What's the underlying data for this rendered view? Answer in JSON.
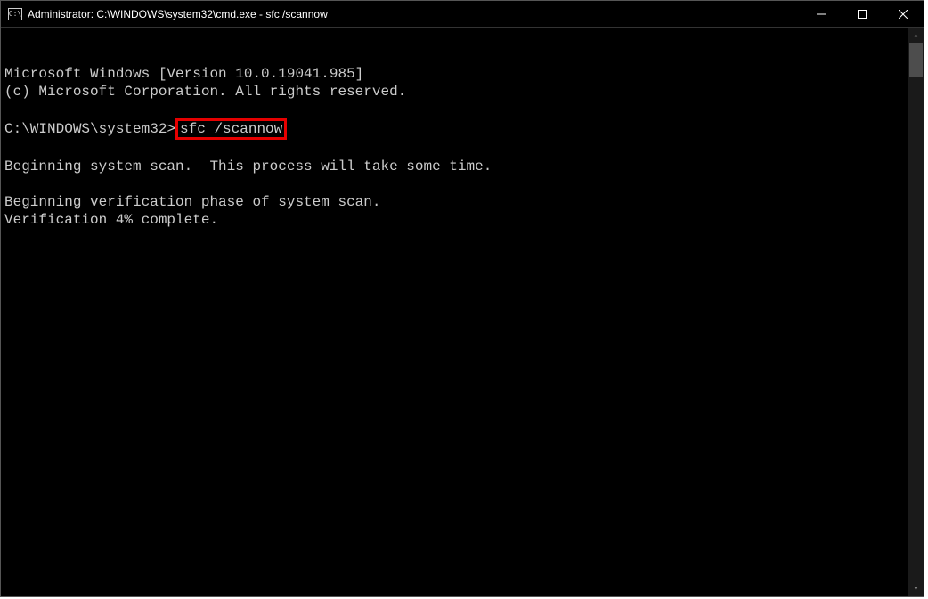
{
  "titlebar": {
    "icon_label": "CMD",
    "title": "Administrator: C:\\WINDOWS\\system32\\cmd.exe - sfc  /scannow"
  },
  "terminal": {
    "line1": "Microsoft Windows [Version 10.0.19041.985]",
    "line2": "(c) Microsoft Corporation. All rights reserved.",
    "prompt": "C:\\WINDOWS\\system32>",
    "command": "sfc /scannow",
    "line_scan": "Beginning system scan.  This process will take some time.",
    "line_verify": "Beginning verification phase of system scan.",
    "line_progress": "Verification 4% complete."
  }
}
